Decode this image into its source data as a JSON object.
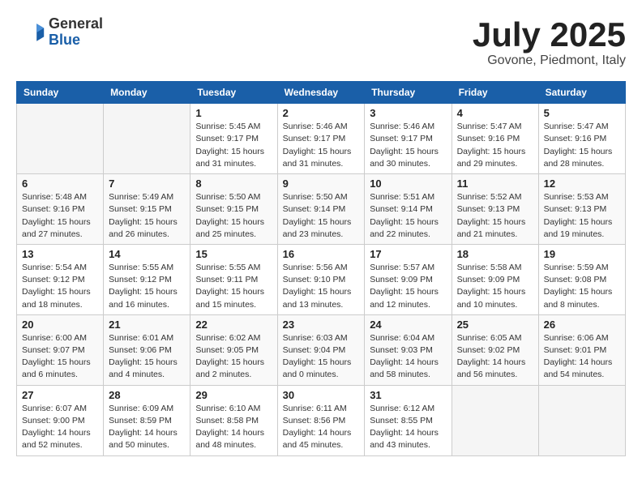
{
  "header": {
    "logo_general": "General",
    "logo_blue": "Blue",
    "month_title": "July 2025",
    "location": "Govone, Piedmont, Italy"
  },
  "days_of_week": [
    "Sunday",
    "Monday",
    "Tuesday",
    "Wednesday",
    "Thursday",
    "Friday",
    "Saturday"
  ],
  "weeks": [
    [
      {
        "day": "",
        "sunrise": "",
        "sunset": "",
        "daylight": ""
      },
      {
        "day": "",
        "sunrise": "",
        "sunset": "",
        "daylight": ""
      },
      {
        "day": "1",
        "sunrise": "Sunrise: 5:45 AM",
        "sunset": "Sunset: 9:17 PM",
        "daylight": "Daylight: 15 hours and 31 minutes."
      },
      {
        "day": "2",
        "sunrise": "Sunrise: 5:46 AM",
        "sunset": "Sunset: 9:17 PM",
        "daylight": "Daylight: 15 hours and 31 minutes."
      },
      {
        "day": "3",
        "sunrise": "Sunrise: 5:46 AM",
        "sunset": "Sunset: 9:17 PM",
        "daylight": "Daylight: 15 hours and 30 minutes."
      },
      {
        "day": "4",
        "sunrise": "Sunrise: 5:47 AM",
        "sunset": "Sunset: 9:16 PM",
        "daylight": "Daylight: 15 hours and 29 minutes."
      },
      {
        "day": "5",
        "sunrise": "Sunrise: 5:47 AM",
        "sunset": "Sunset: 9:16 PM",
        "daylight": "Daylight: 15 hours and 28 minutes."
      }
    ],
    [
      {
        "day": "6",
        "sunrise": "Sunrise: 5:48 AM",
        "sunset": "Sunset: 9:16 PM",
        "daylight": "Daylight: 15 hours and 27 minutes."
      },
      {
        "day": "7",
        "sunrise": "Sunrise: 5:49 AM",
        "sunset": "Sunset: 9:15 PM",
        "daylight": "Daylight: 15 hours and 26 minutes."
      },
      {
        "day": "8",
        "sunrise": "Sunrise: 5:50 AM",
        "sunset": "Sunset: 9:15 PM",
        "daylight": "Daylight: 15 hours and 25 minutes."
      },
      {
        "day": "9",
        "sunrise": "Sunrise: 5:50 AM",
        "sunset": "Sunset: 9:14 PM",
        "daylight": "Daylight: 15 hours and 23 minutes."
      },
      {
        "day": "10",
        "sunrise": "Sunrise: 5:51 AM",
        "sunset": "Sunset: 9:14 PM",
        "daylight": "Daylight: 15 hours and 22 minutes."
      },
      {
        "day": "11",
        "sunrise": "Sunrise: 5:52 AM",
        "sunset": "Sunset: 9:13 PM",
        "daylight": "Daylight: 15 hours and 21 minutes."
      },
      {
        "day": "12",
        "sunrise": "Sunrise: 5:53 AM",
        "sunset": "Sunset: 9:13 PM",
        "daylight": "Daylight: 15 hours and 19 minutes."
      }
    ],
    [
      {
        "day": "13",
        "sunrise": "Sunrise: 5:54 AM",
        "sunset": "Sunset: 9:12 PM",
        "daylight": "Daylight: 15 hours and 18 minutes."
      },
      {
        "day": "14",
        "sunrise": "Sunrise: 5:55 AM",
        "sunset": "Sunset: 9:12 PM",
        "daylight": "Daylight: 15 hours and 16 minutes."
      },
      {
        "day": "15",
        "sunrise": "Sunrise: 5:55 AM",
        "sunset": "Sunset: 9:11 PM",
        "daylight": "Daylight: 15 hours and 15 minutes."
      },
      {
        "day": "16",
        "sunrise": "Sunrise: 5:56 AM",
        "sunset": "Sunset: 9:10 PM",
        "daylight": "Daylight: 15 hours and 13 minutes."
      },
      {
        "day": "17",
        "sunrise": "Sunrise: 5:57 AM",
        "sunset": "Sunset: 9:09 PM",
        "daylight": "Daylight: 15 hours and 12 minutes."
      },
      {
        "day": "18",
        "sunrise": "Sunrise: 5:58 AM",
        "sunset": "Sunset: 9:09 PM",
        "daylight": "Daylight: 15 hours and 10 minutes."
      },
      {
        "day": "19",
        "sunrise": "Sunrise: 5:59 AM",
        "sunset": "Sunset: 9:08 PM",
        "daylight": "Daylight: 15 hours and 8 minutes."
      }
    ],
    [
      {
        "day": "20",
        "sunrise": "Sunrise: 6:00 AM",
        "sunset": "Sunset: 9:07 PM",
        "daylight": "Daylight: 15 hours and 6 minutes."
      },
      {
        "day": "21",
        "sunrise": "Sunrise: 6:01 AM",
        "sunset": "Sunset: 9:06 PM",
        "daylight": "Daylight: 15 hours and 4 minutes."
      },
      {
        "day": "22",
        "sunrise": "Sunrise: 6:02 AM",
        "sunset": "Sunset: 9:05 PM",
        "daylight": "Daylight: 15 hours and 2 minutes."
      },
      {
        "day": "23",
        "sunrise": "Sunrise: 6:03 AM",
        "sunset": "Sunset: 9:04 PM",
        "daylight": "Daylight: 15 hours and 0 minutes."
      },
      {
        "day": "24",
        "sunrise": "Sunrise: 6:04 AM",
        "sunset": "Sunset: 9:03 PM",
        "daylight": "Daylight: 14 hours and 58 minutes."
      },
      {
        "day": "25",
        "sunrise": "Sunrise: 6:05 AM",
        "sunset": "Sunset: 9:02 PM",
        "daylight": "Daylight: 14 hours and 56 minutes."
      },
      {
        "day": "26",
        "sunrise": "Sunrise: 6:06 AM",
        "sunset": "Sunset: 9:01 PM",
        "daylight": "Daylight: 14 hours and 54 minutes."
      }
    ],
    [
      {
        "day": "27",
        "sunrise": "Sunrise: 6:07 AM",
        "sunset": "Sunset: 9:00 PM",
        "daylight": "Daylight: 14 hours and 52 minutes."
      },
      {
        "day": "28",
        "sunrise": "Sunrise: 6:09 AM",
        "sunset": "Sunset: 8:59 PM",
        "daylight": "Daylight: 14 hours and 50 minutes."
      },
      {
        "day": "29",
        "sunrise": "Sunrise: 6:10 AM",
        "sunset": "Sunset: 8:58 PM",
        "daylight": "Daylight: 14 hours and 48 minutes."
      },
      {
        "day": "30",
        "sunrise": "Sunrise: 6:11 AM",
        "sunset": "Sunset: 8:56 PM",
        "daylight": "Daylight: 14 hours and 45 minutes."
      },
      {
        "day": "31",
        "sunrise": "Sunrise: 6:12 AM",
        "sunset": "Sunset: 8:55 PM",
        "daylight": "Daylight: 14 hours and 43 minutes."
      },
      {
        "day": "",
        "sunrise": "",
        "sunset": "",
        "daylight": ""
      },
      {
        "day": "",
        "sunrise": "",
        "sunset": "",
        "daylight": ""
      }
    ]
  ]
}
